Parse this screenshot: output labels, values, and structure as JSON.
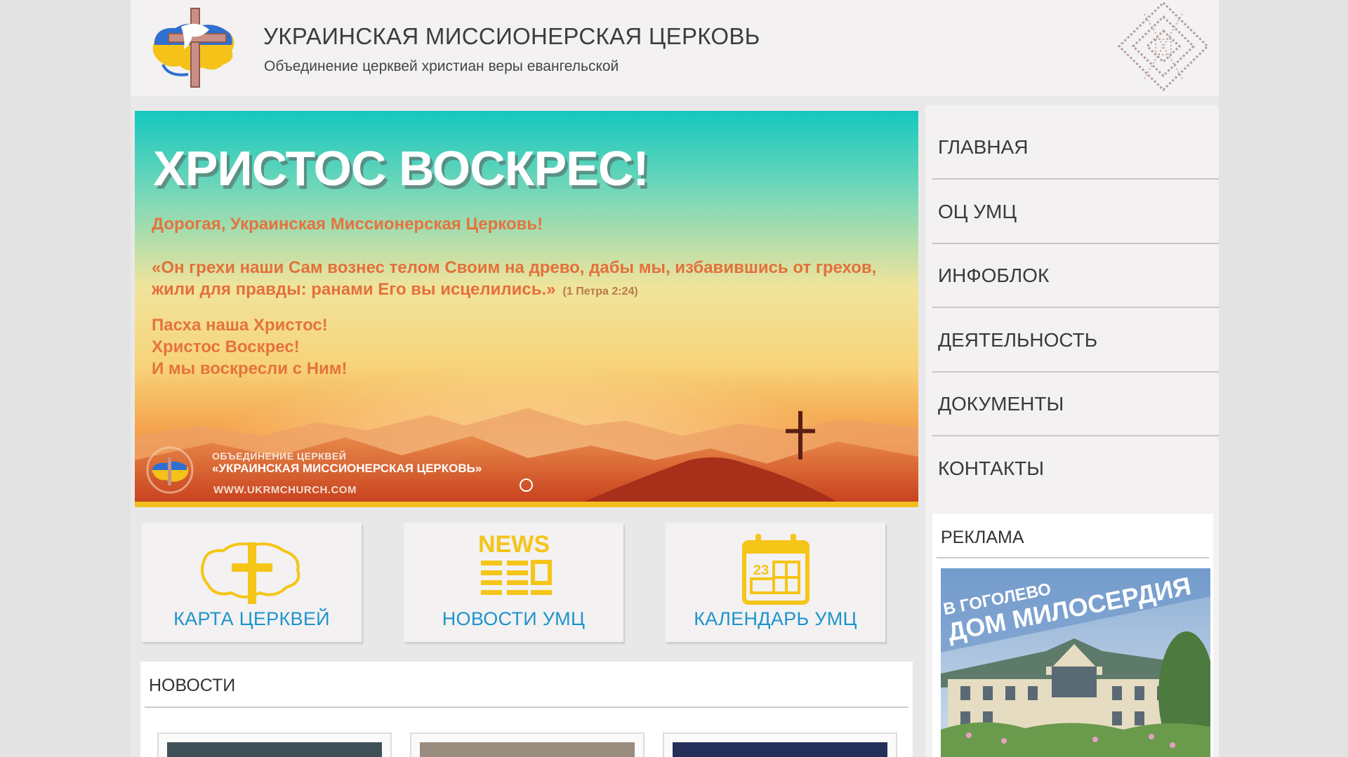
{
  "header": {
    "title": "УКРАИНСКАЯ МИССИОНЕРСКАЯ ЦЕРКОВЬ",
    "subtitle": "Объединение церквей христиан веры евангельской"
  },
  "slider": {
    "title": "ХРИСТОС ВОСКРЕС!",
    "greeting": "Дорогая, Украинская Миссионерская Церковь!",
    "quote": "«Он грехи наши Сам вознес телом Своим на древо, дабы мы, избавившись от грехов, жили для правды: ранами Его вы исцелились.»",
    "quote_ref": "(1 Петра 2:24)",
    "lines": [
      "Пасха наша Христос!",
      "Христос Воскрес!",
      "И мы воскресли с Ним!"
    ],
    "footer_small": "ОБЪЕДИНЕНИЕ ЦЕРКВЕЙ",
    "footer_big": "«УКРАИНСКАЯ МИССИОНЕРСКАЯ ЦЕРКОВЬ»",
    "footer_url": "WWW.UKRMCHURCH.COM",
    "accent": "#f1c01e"
  },
  "tiles": [
    {
      "label": "КАРТА ЦЕРКВЕЙ",
      "icon": "ukraine-map-cross-icon"
    },
    {
      "label": "НОВОСТИ УМЦ",
      "icon": "news-icon",
      "icon_text": "NEWS"
    },
    {
      "label": "КАЛЕНДАРЬ УМЦ",
      "icon": "calendar-icon",
      "icon_text": "23"
    }
  ],
  "news": {
    "title": "НОВОСТИ"
  },
  "nav": [
    {
      "label": "ГЛАВНАЯ"
    },
    {
      "label": "ОЦ УМЦ"
    },
    {
      "label": "ИНФОБЛОК"
    },
    {
      "label": "ДЕЯТЕЛЬНОСТЬ"
    },
    {
      "label": "ДОКУМЕНТЫ"
    },
    {
      "label": "КОНТАКТЫ"
    }
  ],
  "ad": {
    "title": "РЕКЛАМА",
    "banner_line1": "В ГОГОЛЕВО",
    "banner_line2": "ДОМ МИЛОСЕРДИЯ"
  },
  "colors": {
    "link_blue": "#1d94cc",
    "icon_yellow": "#f5c518",
    "slide_text": "#e5733e"
  }
}
